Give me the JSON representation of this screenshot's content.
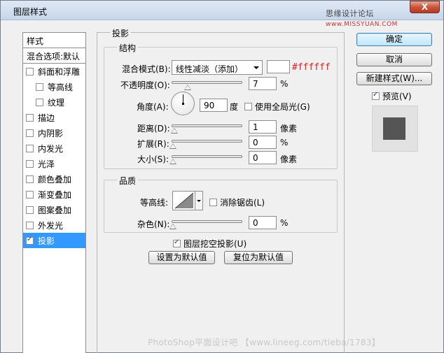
{
  "window": {
    "title": "图层样式",
    "watermark_top": "思缘设计论坛",
    "watermark_site": "www.MISSYUAN.COM",
    "close_symbol": "X"
  },
  "sidebar": {
    "header": "样式",
    "blend_options": "混合选项:默认",
    "items": [
      {
        "label": "斜面和浮雕",
        "checked": false
      },
      {
        "label": "等高线",
        "checked": false
      },
      {
        "label": "纹理",
        "checked": false
      },
      {
        "label": "描边",
        "checked": false
      },
      {
        "label": "内阴影",
        "checked": false
      },
      {
        "label": "内发光",
        "checked": false
      },
      {
        "label": "光泽",
        "checked": false
      },
      {
        "label": "颜色叠加",
        "checked": false
      },
      {
        "label": "渐变叠加",
        "checked": false
      },
      {
        "label": "图案叠加",
        "checked": false
      },
      {
        "label": "外发光",
        "checked": false
      },
      {
        "label": "投影",
        "checked": true
      }
    ]
  },
  "shadow": {
    "section_title": "投影",
    "structure": {
      "title": "结构",
      "blend_mode_label": "混合模式(B):",
      "blend_mode_value": "线性减淡（添加）",
      "color_hex": "#ffffff",
      "opacity_label": "不透明度(O):",
      "opacity_value": "7",
      "opacity_unit": "%",
      "angle_label": "角度(A):",
      "angle_value": "90",
      "angle_unit": "度",
      "global_light_label": "使用全局光(G)",
      "distance_label": "距离(D):",
      "distance_value": "1",
      "distance_unit": "像素",
      "spread_label": "扩展(R):",
      "spread_value": "0",
      "spread_unit": "%",
      "size_label": "大小(S):",
      "size_value": "0",
      "size_unit": "像素"
    },
    "quality": {
      "title": "品质",
      "contour_label": "等高线:",
      "antialias_label": "消除锯齿(L)",
      "noise_label": "杂色(N):",
      "noise_value": "0",
      "noise_unit": "%"
    },
    "knockout_label": "图层挖空投影(U)",
    "make_default": "设置为默认值",
    "reset_default": "复位为默认值"
  },
  "buttons": {
    "ok": "确定",
    "cancel": "取消",
    "new_style": "新建样式(W)...",
    "preview": "预览(V)"
  },
  "watermark_bottom": "PhotoShop平面设计吧 【www.lineeg.com/tieba/1783】",
  "colors": {
    "selected_bg": "#3399ff",
    "hex_text": "#e02020",
    "preview_swatch": "#555555"
  }
}
